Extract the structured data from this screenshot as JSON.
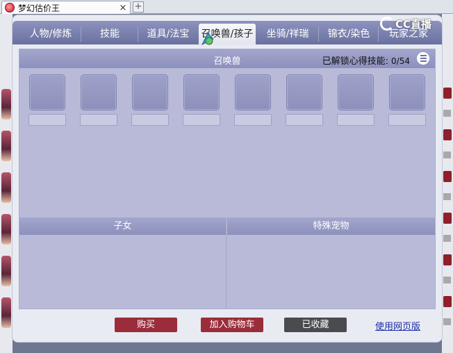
{
  "browser": {
    "tab_title": "梦幻估价王",
    "close_glyph": "×",
    "new_tab_glyph": "+"
  },
  "watermark": {
    "text": "CC直播"
  },
  "nav": {
    "tabs": [
      {
        "label": "人物/修炼"
      },
      {
        "label": "技能"
      },
      {
        "label": "道具/法宝"
      },
      {
        "label": "召唤兽/孩子",
        "active": true
      },
      {
        "label": "坐骑/祥瑞"
      },
      {
        "label": "锦衣/染色"
      },
      {
        "label": "玩家之家"
      }
    ]
  },
  "panel": {
    "title": "召唤兽",
    "skills_label": "已解锁心得技能:",
    "skills_count": "0/54",
    "slots": [
      "",
      "",
      "",
      "",
      "",
      "",
      "",
      ""
    ]
  },
  "children": {
    "title": "子女"
  },
  "special_pets": {
    "title": "特殊宠物"
  },
  "actions": {
    "buy": "购买",
    "add_to_cart": "加入购物车",
    "favorited": "已收藏",
    "web_version": "使用网页版"
  },
  "colors": {
    "nav_bg": "#7a80ad",
    "panel_bg": "#b8bad8",
    "buy_red": "#9b2c3a",
    "fav_gray": "#4a4b4f",
    "link_blue": "#1b2ca8"
  }
}
